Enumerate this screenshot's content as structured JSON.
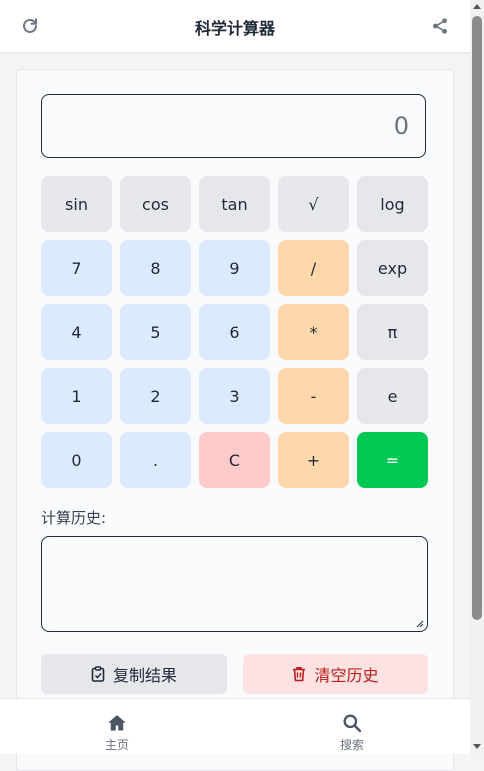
{
  "header": {
    "title": "科学计算器",
    "left_icon": "refresh-icon",
    "right_icon": "share-icon"
  },
  "display": {
    "value": "0"
  },
  "keypad": {
    "rows": [
      [
        {
          "label": "sin",
          "kind": "func"
        },
        {
          "label": "cos",
          "kind": "func"
        },
        {
          "label": "tan",
          "kind": "func"
        },
        {
          "label": "√",
          "kind": "func"
        },
        {
          "label": "log",
          "kind": "func"
        }
      ],
      [
        {
          "label": "7",
          "kind": "num"
        },
        {
          "label": "8",
          "kind": "num"
        },
        {
          "label": "9",
          "kind": "num"
        },
        {
          "label": "/",
          "kind": "op"
        },
        {
          "label": "exp",
          "kind": "func"
        }
      ],
      [
        {
          "label": "4",
          "kind": "num"
        },
        {
          "label": "5",
          "kind": "num"
        },
        {
          "label": "6",
          "kind": "num"
        },
        {
          "label": "*",
          "kind": "op"
        },
        {
          "label": "π",
          "kind": "func"
        }
      ],
      [
        {
          "label": "1",
          "kind": "num"
        },
        {
          "label": "2",
          "kind": "num"
        },
        {
          "label": "3",
          "kind": "num"
        },
        {
          "label": "-",
          "kind": "op"
        },
        {
          "label": "e",
          "kind": "func"
        }
      ],
      [
        {
          "label": "0",
          "kind": "num"
        },
        {
          "label": ".",
          "kind": "num"
        },
        {
          "label": "C",
          "kind": "clear"
        },
        {
          "label": "+",
          "kind": "op"
        },
        {
          "label": "=",
          "kind": "equals"
        }
      ]
    ]
  },
  "history": {
    "label": "计算历史:",
    "value": ""
  },
  "actions": {
    "copy": {
      "label": "复制结果",
      "icon": "clipboard-icon"
    },
    "clear": {
      "label": "清空历史",
      "icon": "trash-icon"
    }
  },
  "nav": {
    "items": [
      {
        "label": "主页",
        "icon": "home-icon"
      },
      {
        "label": "搜索",
        "icon": "search-icon"
      }
    ]
  },
  "colors": {
    "func": "#e5e7eb",
    "num": "#dbeafe",
    "op": "#fed7aa",
    "clear": "#fecaca",
    "equals": "#00c853",
    "clear_history": "#fee2e2",
    "clear_history_text": "#b91c1c"
  }
}
